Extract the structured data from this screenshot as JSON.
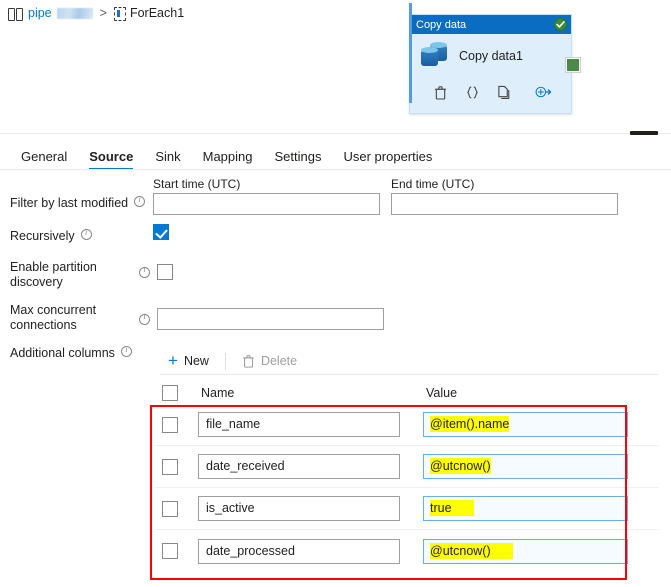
{
  "breadcrumb": {
    "pipeline_label": "pipe",
    "separator": ">",
    "current": "ForEach1",
    "pipeline_icon": "pipeline-icon",
    "foreach_icon": "foreach-icon"
  },
  "activity_node": {
    "header_title": "Copy data",
    "status_icon": "success-check-icon",
    "activity_name": "Copy data1",
    "type_icon": "database-copy-icon",
    "toolbar": [
      {
        "name": "delete-activity-icon",
        "glyph": "trash"
      },
      {
        "name": "code-view-icon",
        "glyph": "braces"
      },
      {
        "name": "clone-activity-icon",
        "glyph": "copy"
      },
      {
        "name": "add-output-icon",
        "glyph": "circle-arrow"
      }
    ],
    "output_port": "output-connector"
  },
  "panel": {
    "collapse_handle": "collapse-panel-handle",
    "tabs": [
      {
        "label": "General",
        "active": false
      },
      {
        "label": "Source",
        "active": true
      },
      {
        "label": "Sink",
        "active": false
      },
      {
        "label": "Mapping",
        "active": false
      },
      {
        "label": "Settings",
        "active": false
      },
      {
        "label": "User properties",
        "active": false
      }
    ]
  },
  "source_form": {
    "filter_by_last_modified": {
      "label": "Filter by last modified",
      "info_icon": "info-icon",
      "start_time": {
        "label": "Start time (UTC)",
        "value": "",
        "placeholder": ""
      },
      "end_time": {
        "label": "End time (UTC)",
        "value": "",
        "placeholder": ""
      }
    },
    "recursively": {
      "label": "Recursively",
      "info_icon": "info-icon",
      "checked": true
    },
    "enable_partition_discovery": {
      "label_line1": "Enable partition",
      "label_line2": "discovery",
      "info_icon": "info-icon",
      "checked": false
    },
    "max_concurrent_connections": {
      "label_line1": "Max concurrent",
      "label_line2": "connections",
      "info_icon": "info-icon",
      "value": "",
      "placeholder": ""
    },
    "additional_columns": {
      "label": "Additional columns",
      "info_icon": "info-icon",
      "toolbar": {
        "new_label": "New",
        "new_icon": "plus-icon",
        "delete_label": "Delete",
        "delete_icon": "trash-icon",
        "delete_enabled": false
      },
      "columns": [
        "Name",
        "Value"
      ],
      "select_all_checked": false,
      "rows": [
        {
          "selected": false,
          "name": "file_name",
          "value": "@item().name",
          "highlight": true
        },
        {
          "selected": false,
          "name": "date_received",
          "value": "@utcnow()",
          "highlight": true
        },
        {
          "selected": false,
          "name": "is_active",
          "value": "true",
          "highlight": true
        },
        {
          "selected": false,
          "name": "date_processed",
          "value": "@utcnow()",
          "highlight": true
        }
      ]
    }
  },
  "annotation": {
    "shape": "red-rectangle-highlight",
    "color": "#ff0000"
  },
  "colors": {
    "accent": "#0078d4",
    "node_header": "#0b6dc1",
    "node_body": "#deeefb",
    "success": "#3a8a3a",
    "highlight": "#ffff00",
    "annotation": "#ff0000"
  }
}
